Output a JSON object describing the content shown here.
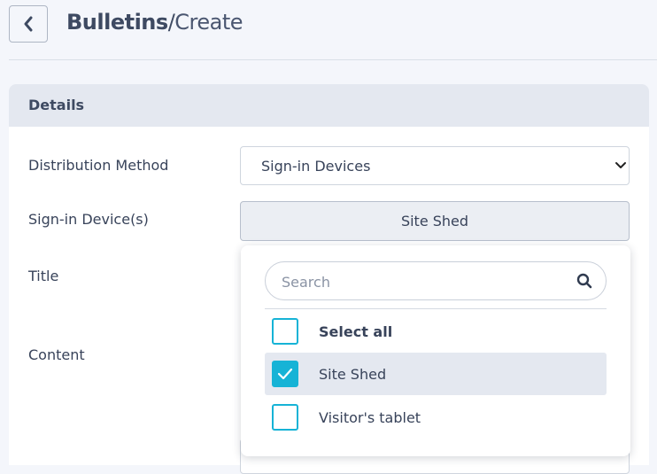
{
  "header": {
    "section": "Bulletins",
    "separator": "/",
    "page": "Create"
  },
  "card": {
    "title": "Details",
    "labels": {
      "distribution": "Distribution Method",
      "devices": "Sign-in Device(s)",
      "title": "Title",
      "content": "Content"
    },
    "distribution_value": "Sign-in Devices",
    "devices_value": "Site Shed"
  },
  "dropdown": {
    "search_placeholder": "Search",
    "options": [
      {
        "label": "Select all",
        "checked": false
      },
      {
        "label": "Site Shed",
        "checked": true
      },
      {
        "label": "Visitor's tablet",
        "checked": false
      }
    ]
  },
  "colors": {
    "accent": "#16b3d6",
    "card_header_bg": "#e4e8f0",
    "page_bg": "#f4f6fb"
  }
}
